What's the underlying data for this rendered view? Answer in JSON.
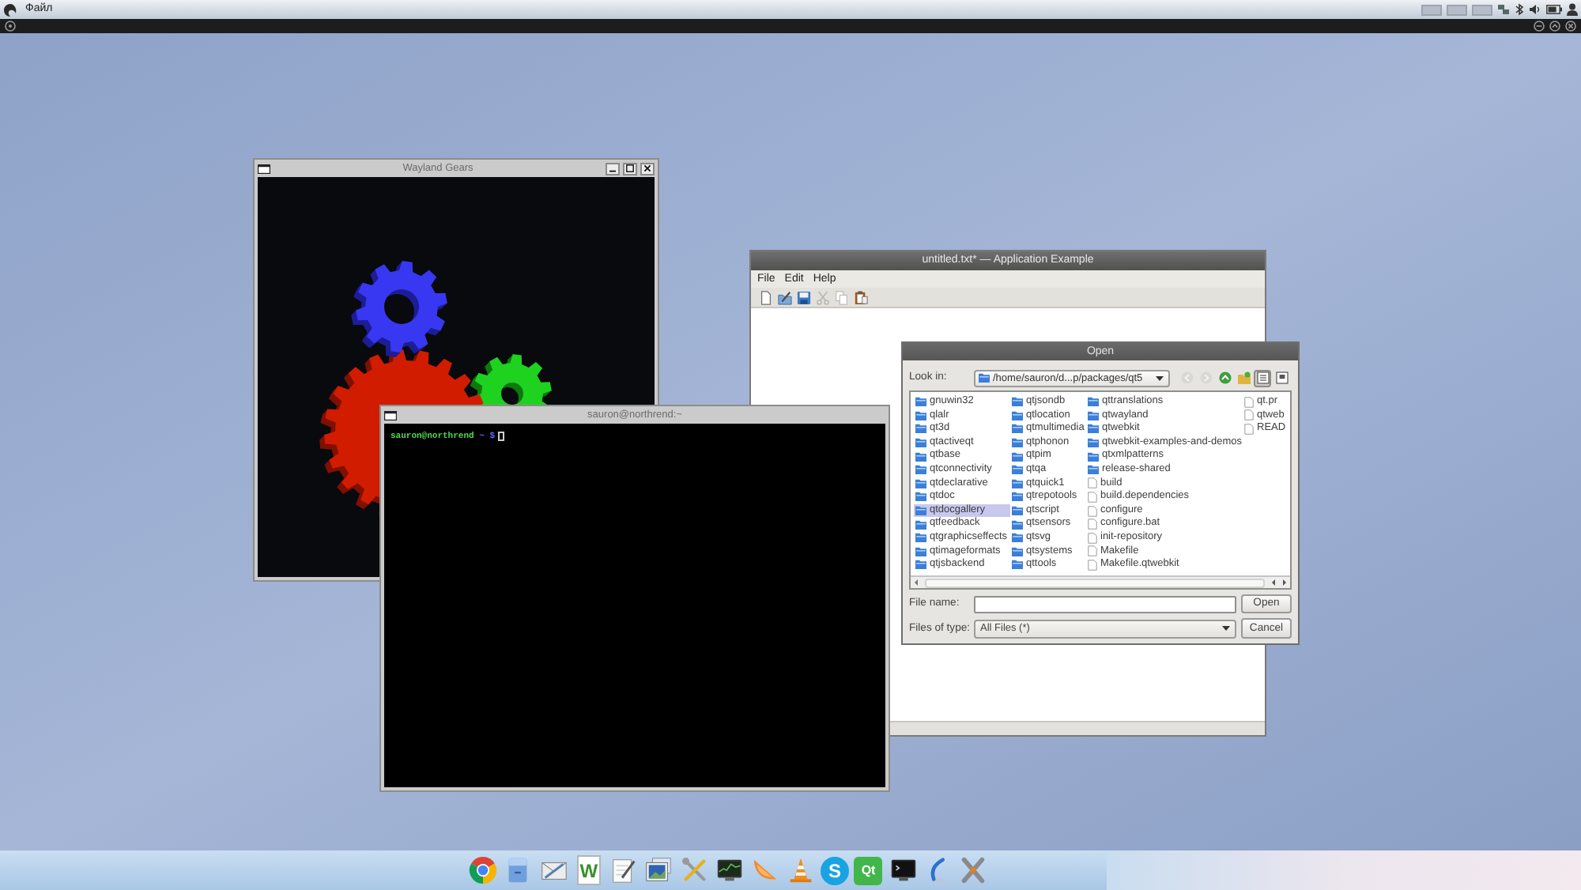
{
  "top_panel": {
    "menu": [
      "Файл"
    ]
  },
  "gears_window": {
    "title": "Wayland Gears"
  },
  "editor_window": {
    "title": "untitled.txt* — Application Example",
    "menu": [
      "File",
      "Edit",
      "Help"
    ],
    "toolbar": [
      {
        "kind": "new",
        "disabled": false
      },
      {
        "kind": "open",
        "disabled": false
      },
      {
        "kind": "save",
        "disabled": false
      },
      {
        "kind": "cut",
        "disabled": true
      },
      {
        "kind": "copy",
        "disabled": true
      },
      {
        "kind": "paste",
        "disabled": false
      }
    ]
  },
  "open_dialog": {
    "title": "Open",
    "look_in": {
      "label": "Look in:",
      "value": "/home/sauron/d...p/packages/qt5"
    },
    "nav_buttons": [
      {
        "kind": "back",
        "disabled": true,
        "selected": false
      },
      {
        "kind": "forward",
        "disabled": true,
        "selected": false
      },
      {
        "kind": "up",
        "disabled": false,
        "selected": false
      },
      {
        "kind": "new_folder",
        "disabled": false,
        "selected": false
      },
      {
        "kind": "list_view",
        "disabled": false,
        "selected": true
      },
      {
        "kind": "detail_view",
        "disabled": false,
        "selected": false
      }
    ],
    "files": [
      {
        "name": "gnuwin32",
        "kind": "folder",
        "selected": false
      },
      {
        "name": "qlalr",
        "kind": "folder",
        "selected": false
      },
      {
        "name": "qt3d",
        "kind": "folder",
        "selected": false
      },
      {
        "name": "qtactiveqt",
        "kind": "folder",
        "selected": false
      },
      {
        "name": "qtbase",
        "kind": "folder",
        "selected": false
      },
      {
        "name": "qtconnectivity",
        "kind": "folder",
        "selected": false
      },
      {
        "name": "qtdeclarative",
        "kind": "folder",
        "selected": false
      },
      {
        "name": "qtdoc",
        "kind": "folder",
        "selected": false
      },
      {
        "name": "qtdocgallery",
        "kind": "folder",
        "selected": true
      },
      {
        "name": "qtfeedback",
        "kind": "folder",
        "selected": false
      },
      {
        "name": "qtgraphicseffects",
        "kind": "folder",
        "selected": false
      },
      {
        "name": "qtimageformats",
        "kind": "folder",
        "selected": false
      },
      {
        "name": "qtjsbackend",
        "kind": "folder",
        "selected": false
      },
      {
        "name": "qtjsondb",
        "kind": "folder",
        "selected": false
      },
      {
        "name": "qtlocation",
        "kind": "folder",
        "selected": false
      },
      {
        "name": "qtmultimedia",
        "kind": "folder",
        "selected": false
      },
      {
        "name": "qtphonon",
        "kind": "folder",
        "selected": false
      },
      {
        "name": "qtpim",
        "kind": "folder",
        "selected": false
      },
      {
        "name": "qtqa",
        "kind": "folder",
        "selected": false
      },
      {
        "name": "qtquick1",
        "kind": "folder",
        "selected": false
      },
      {
        "name": "qtrepotools",
        "kind": "folder",
        "selected": false
      },
      {
        "name": "qtscript",
        "kind": "folder",
        "selected": false
      },
      {
        "name": "qtsensors",
        "kind": "folder",
        "selected": false
      },
      {
        "name": "qtsvg",
        "kind": "folder",
        "selected": false
      },
      {
        "name": "qtsystems",
        "kind": "folder",
        "selected": false
      },
      {
        "name": "qttools",
        "kind": "folder",
        "selected": false
      },
      {
        "name": "qttranslations",
        "kind": "folder",
        "selected": false
      },
      {
        "name": "qtwayland",
        "kind": "folder",
        "selected": false
      },
      {
        "name": "qtwebkit",
        "kind": "folder",
        "selected": false
      },
      {
        "name": "qtwebkit-examples-and-demos",
        "kind": "folder",
        "selected": false
      },
      {
        "name": "qtxmlpatterns",
        "kind": "folder",
        "selected": false
      },
      {
        "name": "release-shared",
        "kind": "folder",
        "selected": false
      },
      {
        "name": "build",
        "kind": "file",
        "selected": false
      },
      {
        "name": "build.dependencies",
        "kind": "file",
        "selected": false
      },
      {
        "name": "configure",
        "kind": "file",
        "selected": false
      },
      {
        "name": "configure.bat",
        "kind": "file",
        "selected": false
      },
      {
        "name": "init-repository",
        "kind": "file",
        "selected": false
      },
      {
        "name": "Makefile",
        "kind": "file",
        "selected": false
      },
      {
        "name": "Makefile.qtwebkit",
        "kind": "file",
        "selected": false
      },
      {
        "name": "qt.pr",
        "kind": "file",
        "selected": false
      },
      {
        "name": "qtweb",
        "kind": "file",
        "selected": false
      },
      {
        "name": "READ",
        "kind": "file",
        "selected": false
      }
    ],
    "file_name": {
      "label": "File name:"
    },
    "open_button": "Open",
    "file_type": {
      "label": "Files of type:",
      "value": "All Files (*)"
    },
    "cancel_button": "Cancel"
  },
  "terminal_window": {
    "title": "sauron@northrend:~",
    "prompt": {
      "user_host": "sauron@northrend",
      "path": "~",
      "symbol": "$"
    }
  },
  "dock": [
    {
      "kind": "circle"
    },
    {
      "kind": "cabinet"
    },
    {
      "kind": "envelope"
    },
    {
      "kind": "letter",
      "label": "W"
    },
    {
      "kind": "notepad"
    },
    {
      "kind": "picture"
    },
    {
      "kind": "tools"
    },
    {
      "kind": "monitor"
    },
    {
      "kind": "slice"
    },
    {
      "kind": "cone"
    },
    {
      "kind": "disc",
      "label": "S"
    },
    {
      "kind": "tile",
      "label": "Qt"
    },
    {
      "kind": "terminal"
    },
    {
      "kind": "pen"
    },
    {
      "kind": "crossed"
    }
  ]
}
